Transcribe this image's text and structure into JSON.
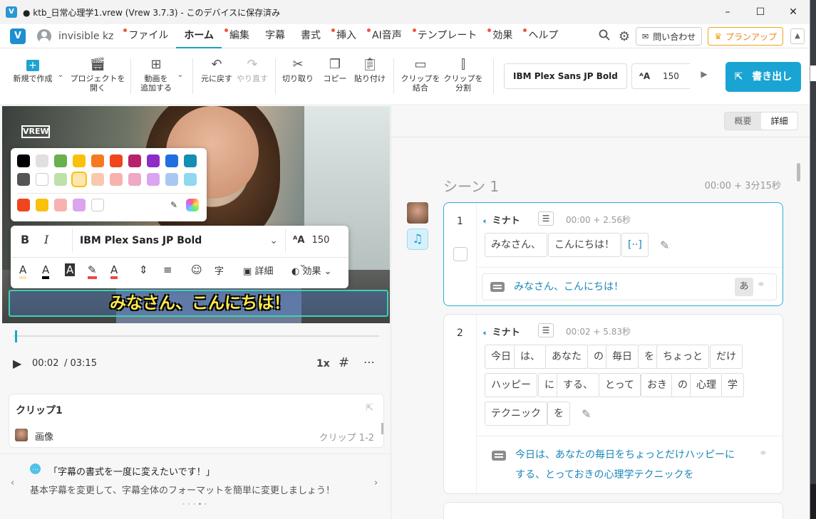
{
  "window": {
    "title": "● ktb_日常心理学1.vrew (Vrew 3.7.3) - このデバイスに保存済み",
    "minimize": "–",
    "maximize": "☐",
    "close": "✕"
  },
  "menubar": {
    "logo": "V",
    "user": "invisible kz",
    "menus": [
      {
        "label": "ファイル",
        "dot": true
      },
      {
        "label": "ホーム",
        "active": true
      },
      {
        "label": "編集",
        "dot": true
      },
      {
        "label": "字幕"
      },
      {
        "label": "書式"
      },
      {
        "label": "挿入",
        "dot": true
      },
      {
        "label": "AI音声",
        "dot": true
      },
      {
        "label": "テンプレート",
        "dot": true
      },
      {
        "label": "効果",
        "dot": true
      },
      {
        "label": "ヘルプ",
        "dot": true
      }
    ],
    "contact": "問い合わせ",
    "plan": "プランアップ"
  },
  "toolbar": {
    "new": "新規で作成",
    "open_line1": "プロジェクトを",
    "open_line2": "開く",
    "add_line1": "動画を",
    "add_line2": "追加する",
    "undo": "元に戻す",
    "redo": "やり直す",
    "cut": "切り取り",
    "copy": "コピー",
    "paste": "貼り付け",
    "merge_line1": "クリップを",
    "merge_line2": "結合",
    "split_line1": "クリップを",
    "split_line2": "分割",
    "font": "IBM Plex Sans JP Bold",
    "size": "150",
    "export": "書き出し"
  },
  "preview": {
    "watermark": "VREW",
    "caption": "みなさん、こんにちは！",
    "palette_row1": [
      "#000000",
      "#e0e0e0",
      "#6ab04c",
      "#f9c10b",
      "#f57a1f",
      "#f0451d",
      "#b8226a",
      "#8e2cc7",
      "#1f6fe0",
      "#138eb4"
    ],
    "palette_row2": [
      "#555555",
      "#ffffff",
      "#bfe0a8",
      "#fde6b0",
      "#fac8b0",
      "#f7b2b0",
      "#f0a8c6",
      "#dba4ef",
      "#a8c8f2",
      "#8fd8ef"
    ],
    "palette_row3": [
      "#f0451d",
      "#f9c10b",
      "#f7b2b0",
      "#dba4ef",
      "#ffffff"
    ],
    "fmt_font": "IBM Plex Sans JP Bold",
    "fmt_size": "150",
    "fmt_detail": "詳細",
    "fmt_effect": "効果",
    "bold": "B",
    "italic": "I"
  },
  "player": {
    "current": "00:02",
    "total": "/ 03:15",
    "speed": "1x"
  },
  "clip": {
    "title": "クリップ1",
    "type": "画像",
    "range": "クリップ 1-2"
  },
  "tip": {
    "title": "「字幕の書式を一度に変えたいです！」",
    "body": "基本字幕を変更して、字幕全体のフォーマットを簡単に変更しましょう！"
  },
  "right": {
    "view_summary": "概要",
    "view_detail": "詳細",
    "scene_title": "シーン 1",
    "scene_time": "00:00 + 3分15秒"
  },
  "cards": [
    {
      "num": "1",
      "speaker": "ミナト",
      "time": "00:00 + 2.56秒",
      "words": [
        "みなさん、",
        "こんにちは！",
        "[··]"
      ],
      "subtitle": "みなさん、こんにちは！",
      "lang_btn": "あ"
    },
    {
      "num": "2",
      "speaker": "ミナト",
      "time": "00:02 + 5.83秒",
      "words_row1": [
        "今日",
        "は、",
        "あなた",
        "の",
        "毎日",
        "を",
        "ちょっと",
        "だけ"
      ],
      "words_row2": [
        "ハッピー",
        "に",
        "する、",
        "とって",
        "おき",
        "の",
        "心理",
        "学"
      ],
      "words_row3": [
        "テクニック",
        "を"
      ],
      "subtitle_line1": "今日は、あなたの毎日をちょっとだけハッピーに",
      "subtitle_line2": "する、とっておきの心理学テクニックを"
    }
  ]
}
